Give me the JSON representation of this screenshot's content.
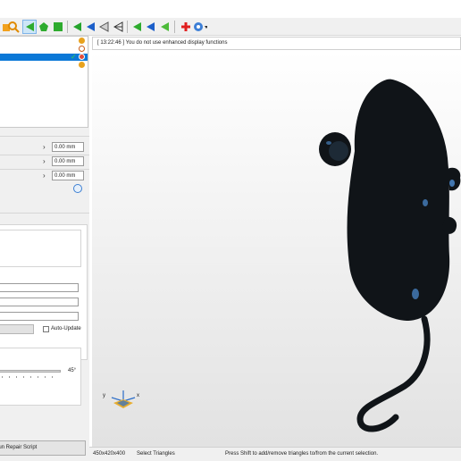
{
  "log": {
    "message": "[ 13:22:46 ] You do not use enhanced display functions"
  },
  "parameters": [
    {
      "value": "0.00 mm"
    },
    {
      "value": "0.00 mm"
    },
    {
      "value": "0.00 mm"
    }
  ],
  "options": {
    "auto_update_label": "Auto-Update",
    "angle_value": "45°"
  },
  "actions": {
    "run_repair_label": "Run Repair Script",
    "run_repair_visible": "Run Repair Script"
  },
  "status_bar": {
    "dimensions": "450x420x400",
    "mode": "Select Triangles",
    "hint": "Press Shift to add/remove triangles to/from the current selection."
  },
  "axes": {
    "x_label": "x",
    "y_label": "y"
  },
  "colors": {
    "accent": "#0a78d7",
    "model": "#101418",
    "viewport_top": "#ffffff",
    "viewport_bottom": "#e2e2e2"
  }
}
